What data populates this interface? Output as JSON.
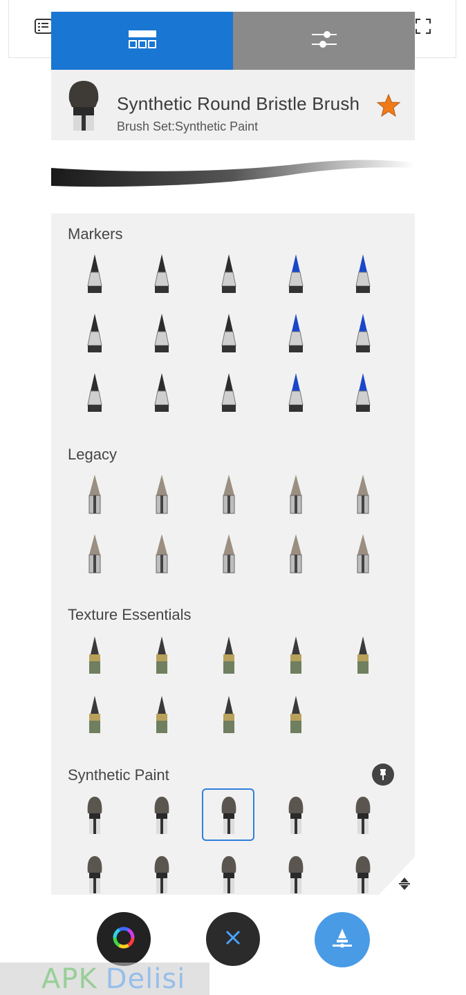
{
  "toolbar": {
    "icons": [
      "list-icon",
      "fullscreen-icon"
    ]
  },
  "tabs": [
    {
      "label": "Brush Library",
      "icon": "brush-library-icon",
      "active": true
    },
    {
      "label": "Brush Properties",
      "icon": "sliders-icon",
      "active": false
    }
  ],
  "current_brush": {
    "name": "Synthetic Round Bristle Brush",
    "set_line": "Brush Set:Synthetic Paint",
    "favorite": true
  },
  "sections": [
    {
      "title": "Markers",
      "count": 15
    },
    {
      "title": "Legacy",
      "count": 10
    },
    {
      "title": "Texture Essentials",
      "count": 9
    },
    {
      "title": "Synthetic Paint",
      "count": 10,
      "selected_index": 2,
      "pinned": true
    }
  ],
  "colors": {
    "tab_active": "#1976d2",
    "tab_inactive": "#8a8a8a",
    "panel_bg": "#f1f1f1",
    "selection": "#2f7fd9",
    "star": "#f07a1a",
    "fab_accent": "#4a9be6"
  },
  "fabs": [
    "color-wheel-icon",
    "close-icon",
    "brush-icon"
  ],
  "watermark": {
    "apk": "APK",
    "delisi": "Delisi"
  }
}
